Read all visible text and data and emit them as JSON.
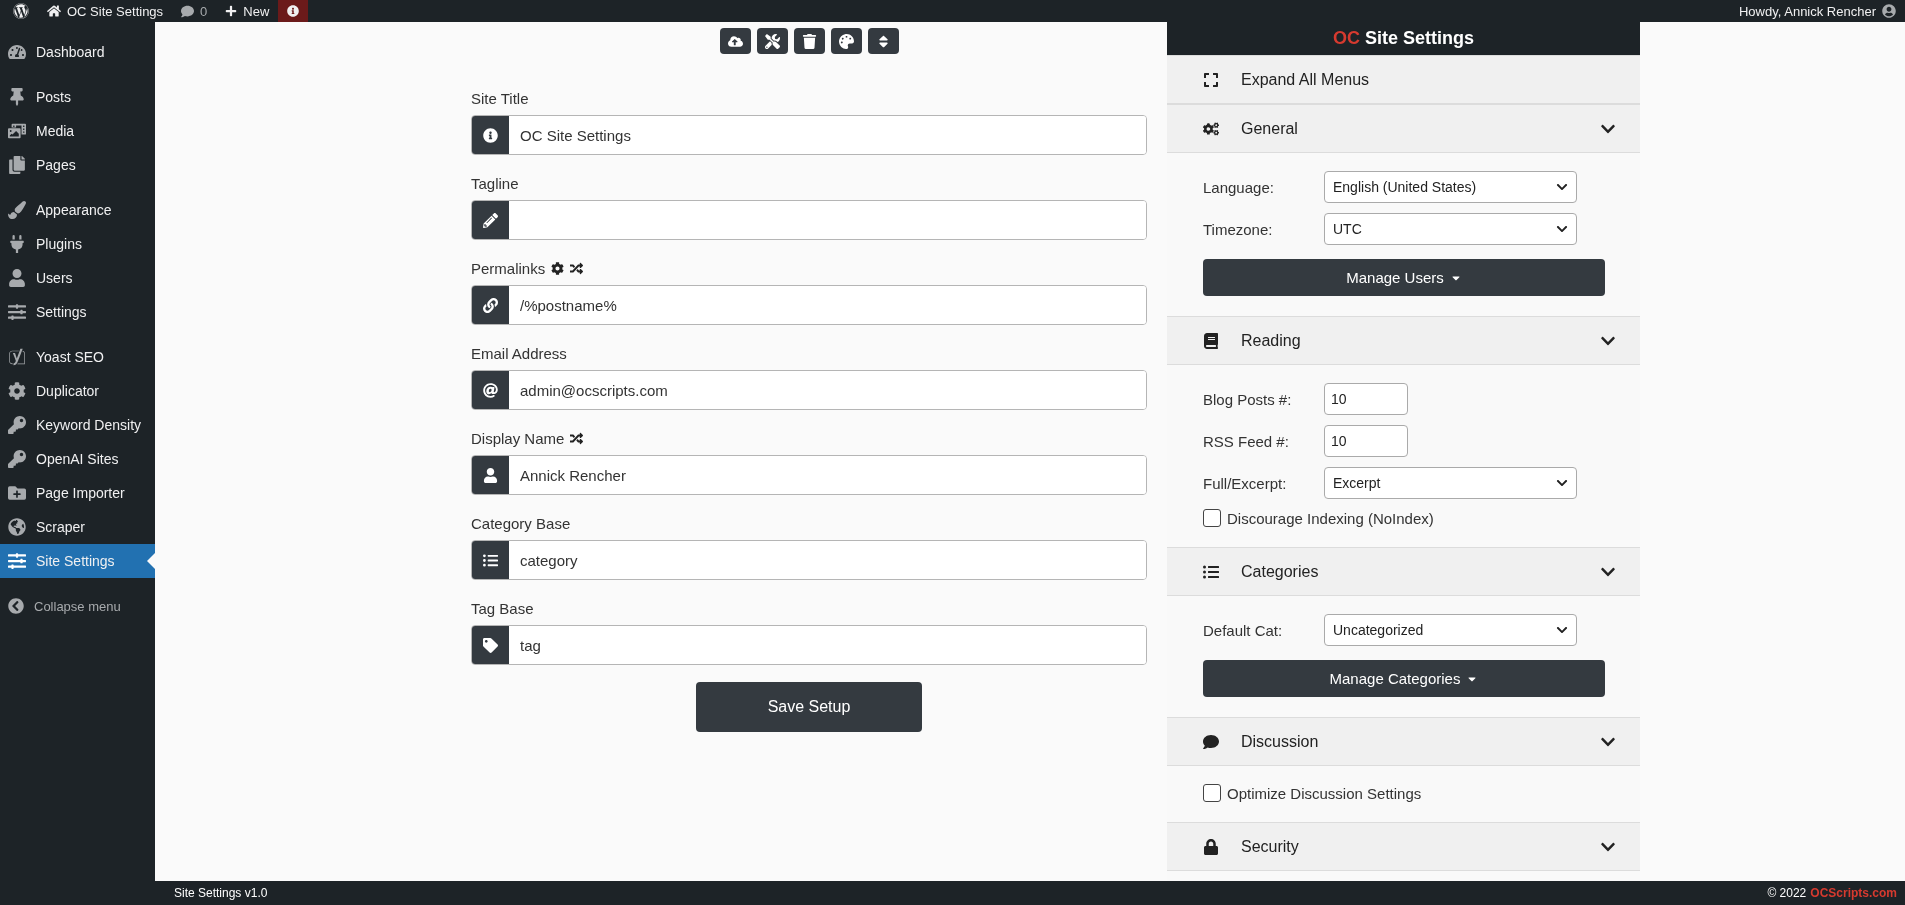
{
  "topbar": {
    "site_title": "OC Site Settings",
    "comments_count": "0",
    "new_label": "New",
    "greeting": "Howdy, Annick Rencher"
  },
  "sidebar": {
    "groups": [
      {
        "items": [
          {
            "label": "Dashboard",
            "selected": false
          }
        ]
      },
      {
        "items": [
          {
            "label": "Posts",
            "selected": false
          },
          {
            "label": "Media",
            "selected": false
          },
          {
            "label": "Pages",
            "selected": false
          }
        ]
      },
      {
        "items": [
          {
            "label": "Appearance",
            "selected": false
          },
          {
            "label": "Plugins",
            "selected": false
          },
          {
            "label": "Users",
            "selected": false
          },
          {
            "label": "Settings",
            "selected": false
          }
        ]
      },
      {
        "items": [
          {
            "label": "Yoast SEO",
            "selected": false
          },
          {
            "label": "Duplicator",
            "selected": false
          },
          {
            "label": "Keyword Density",
            "selected": false
          },
          {
            "label": "OpenAI Sites",
            "selected": false
          },
          {
            "label": "Page Importer",
            "selected": false
          },
          {
            "label": "Scraper",
            "selected": false
          },
          {
            "label": "Site Settings",
            "selected": true
          }
        ]
      }
    ],
    "collapse_label": "Collapse menu"
  },
  "form": {
    "fields": [
      {
        "label": "Site Title",
        "value": "OC Site Settings"
      },
      {
        "label": "Tagline"
      },
      {
        "label": "Permalinks",
        "value": "/%postname%"
      },
      {
        "label": "Email Address",
        "value": "admin@ocscripts.com"
      },
      {
        "label": "Display Name",
        "value": "Annick Rencher"
      },
      {
        "label": "Category Base",
        "value": "category"
      },
      {
        "label": "Tag Base",
        "value": "tag"
      }
    ],
    "save_button": "Save Setup"
  },
  "panel": {
    "brand": "OC",
    "title": "Site Settings",
    "expand_all": "Expand All Menus",
    "sections": [
      {
        "title": "General",
        "expanded": true,
        "rows": [
          {
            "kind": "select",
            "label": "Language:",
            "value": "English (United States)"
          },
          {
            "kind": "select",
            "label": "Timezone:",
            "value": "UTC"
          },
          {
            "kind": "dropdown_button",
            "label": "Manage Users"
          }
        ]
      },
      {
        "title": "Reading",
        "expanded": true,
        "rows": [
          {
            "kind": "number",
            "label": "Blog Posts #:",
            "value": "10"
          },
          {
            "kind": "number",
            "label": "RSS Feed #:",
            "value": "10"
          },
          {
            "kind": "select",
            "label": "Full/Excerpt:",
            "value": "Excerpt"
          },
          {
            "kind": "checkbox",
            "label": "Discourage Indexing (NoIndex)",
            "checked": false
          }
        ]
      },
      {
        "title": "Categories",
        "expanded": true,
        "rows": [
          {
            "kind": "select",
            "label": "Default Cat:",
            "value": "Uncategorized"
          },
          {
            "kind": "dropdown_button",
            "label": "Manage Categories"
          }
        ]
      },
      {
        "title": "Discussion",
        "expanded": true,
        "rows": [
          {
            "kind": "checkbox",
            "label": "Optimize Discussion Settings",
            "checked": false
          }
        ]
      },
      {
        "title": "Security",
        "expanded": false
      }
    ]
  },
  "footer": {
    "version": "Site Settings v1.0",
    "copyright": "© 2022",
    "link": "OCScripts.com"
  }
}
